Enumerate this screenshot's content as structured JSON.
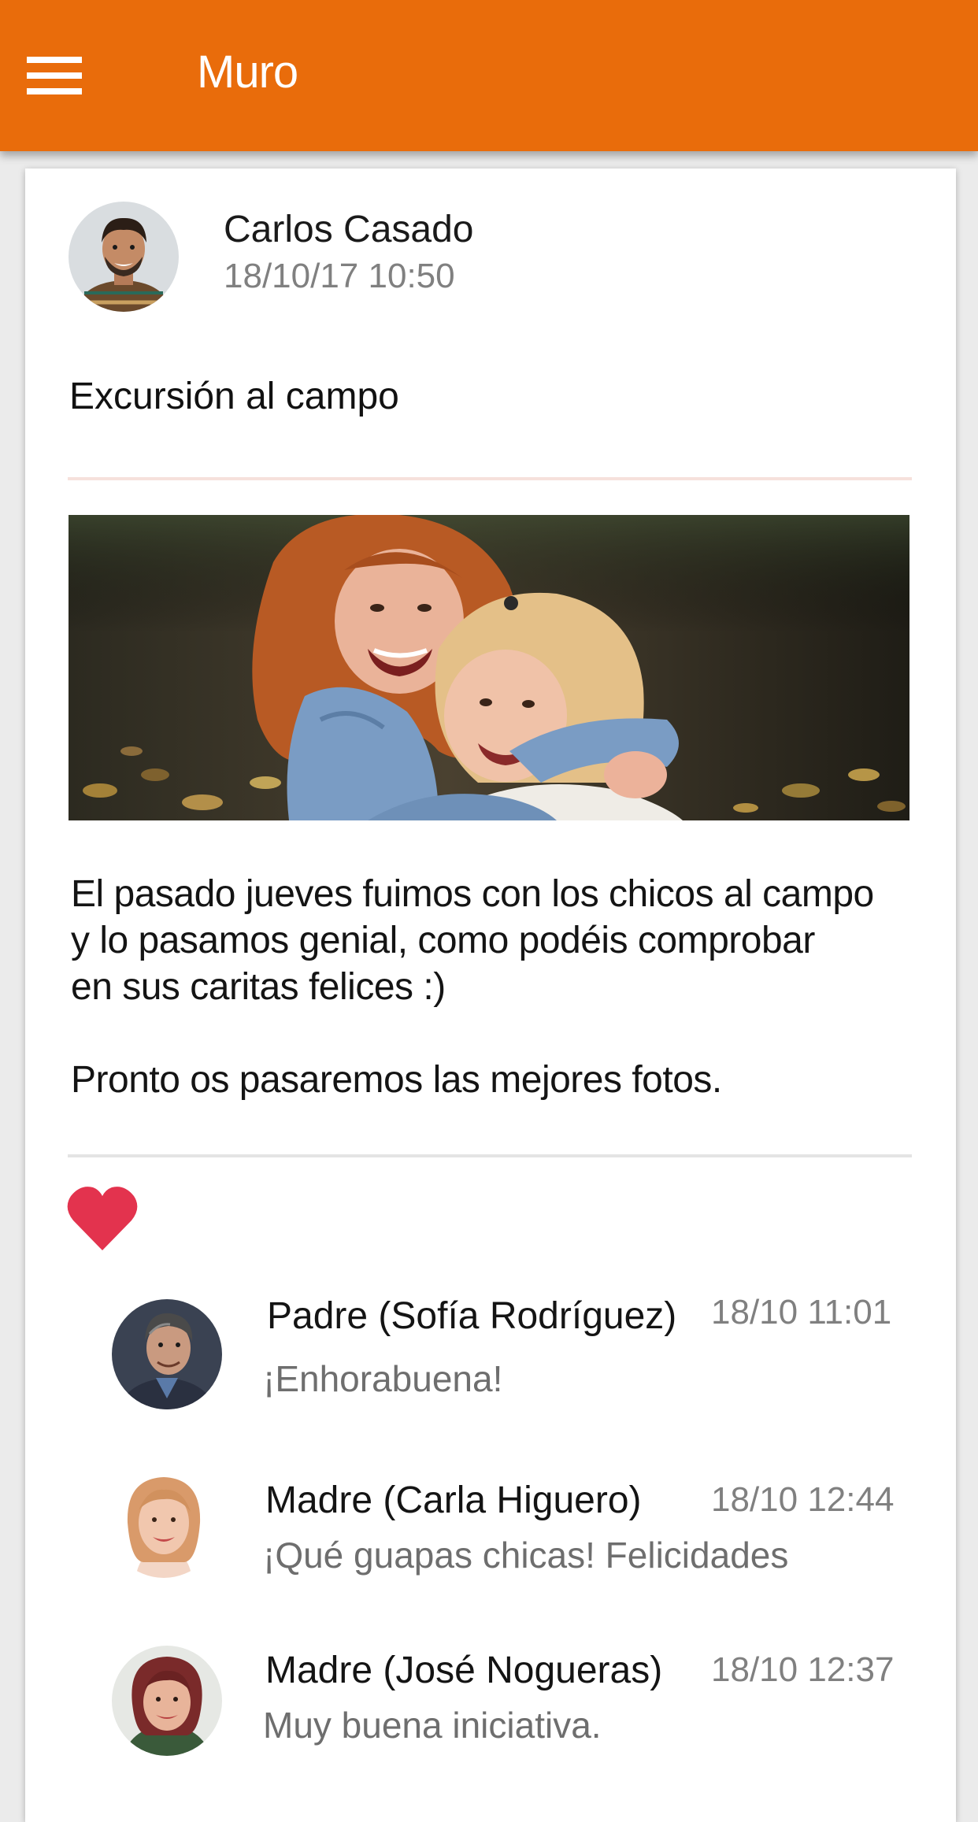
{
  "app_bar": {
    "title": "Muro",
    "menu_icon": "hamburger-menu-icon",
    "background": "#e96c0b"
  },
  "post": {
    "author": "Carlos Casado",
    "date": "18/10/17  10:50",
    "title": "Excursión al campo",
    "image_description": "two-girls-hugging-photo",
    "body": [
      "El pasado jueves fuimos con los chicos al campo",
      "y lo pasamos genial, como podéis comprobar",
      "en sus caritas felices :)",
      "Pronto os pasaremos las mejores fotos."
    ],
    "like_icon": "heart-icon",
    "like_color": "#e3334e"
  },
  "comments": [
    {
      "name": "Padre (Sofía Rodríguez)",
      "time": "18/10  11:01",
      "text": "¡Enhorabuena!"
    },
    {
      "name": "Madre (Carla Higuero)",
      "time": "18/10 12:44",
      "text": "¡Qué guapas chicas! Felicidades"
    },
    {
      "name": "Madre (José Nogueras)",
      "time": "18/10 12:37",
      "text": "Muy buena iniciativa."
    }
  ]
}
